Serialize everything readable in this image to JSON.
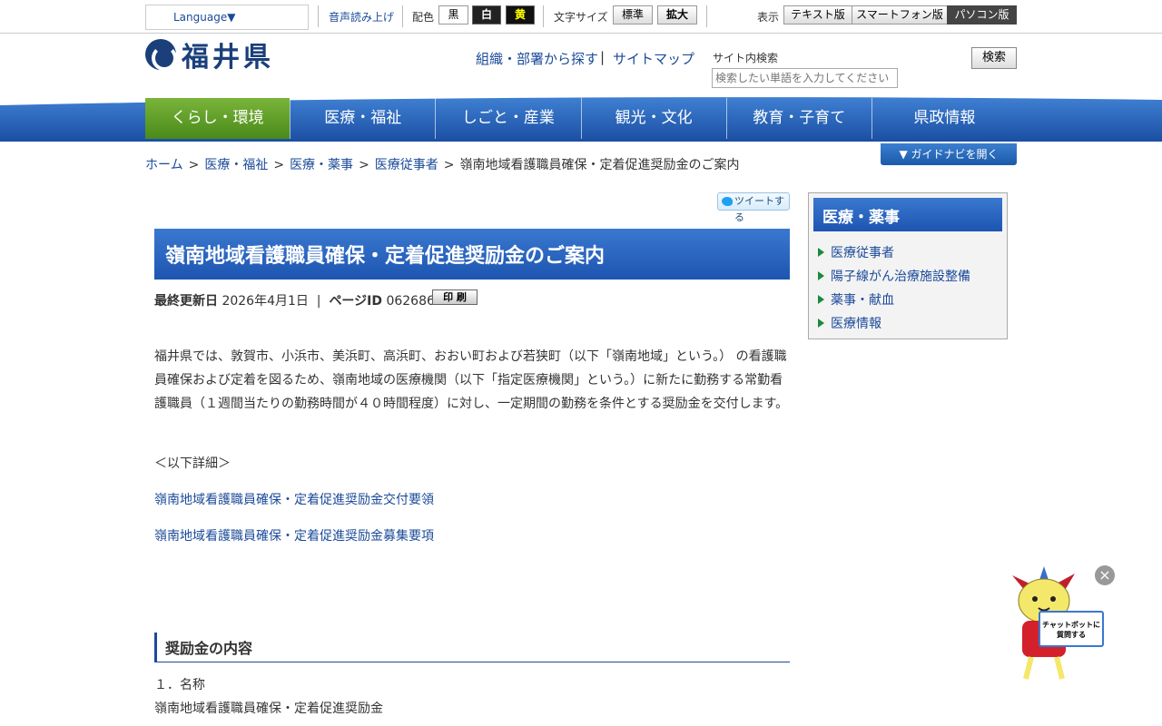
{
  "topbar": {
    "language": "Language▼",
    "voice": "音声読み上げ",
    "color_label": "配色",
    "color_black": "黒",
    "color_white": "白",
    "color_yellow": "黄",
    "font_label": "文字サイズ",
    "font_standard": "標準",
    "font_large": "拡大",
    "display_label": "表示",
    "view_text": "テキスト版",
    "view_smartphone": "スマートフォン版",
    "view_pc": "パソコン版"
  },
  "header": {
    "logo_text": "福井県",
    "org_search": "組織・部署から探す",
    "sitemap": "サイトマップ",
    "search_label": "サイト内検索",
    "search_placeholder": "検索したい単語を入力してください",
    "search_button": "検索"
  },
  "nav": {
    "items": [
      "くらし・環境",
      "医療・福祉",
      "しごと・産業",
      "観光・文化",
      "教育・子育て",
      "県政情報"
    ],
    "guide_button": "▼ ガイドナビを開く"
  },
  "breadcrumb": [
    "ホーム",
    "医療・福祉",
    "医療・薬事",
    "医療従事者",
    "嶺南地域看護職員確保・定着促進奨励金のご案内"
  ],
  "main": {
    "tweet": "ツイートする",
    "title": "嶺南地域看護職員確保・定着促進奨励金のご案内",
    "updated_label": "最終更新日",
    "updated_value": "2026年4月1日",
    "page_id_label": "ページID",
    "page_id_value": "062686",
    "print": "印 刷",
    "intro": "福井県では、敦賀市、小浜市、美浜町、高浜町、おおい町および若狭町（以下「嶺南地域」という。） の看護職員確保および定着を図るため、嶺南地域の医療機関（以下「指定医療機関」という。）に新たに勤務する常勤看護職員（１週間当たりの勤務時間が４０時間程度）に対し、一定期間の勤務を条件とする奨励金を交付します。",
    "detail": "＜以下詳細＞",
    "link1": "嶺南地域看護職員確保・定着促進奨励金交付要領",
    "link2": "嶺南地域看護職員確保・定着促進奨励金募集要項",
    "section_heading": "奨励金の内容",
    "item1_heading": "１．名称",
    "item1_value": "嶺南地域看護職員確保・定着促進奨励金"
  },
  "sidebar": {
    "title": "医療・薬事",
    "items": [
      "医療従事者",
      "陽子線がん治療施設整備",
      "薬事・献血",
      "医療情報"
    ]
  },
  "chatbot": {
    "sign": "チャットボットに質問する",
    "close": "×"
  }
}
